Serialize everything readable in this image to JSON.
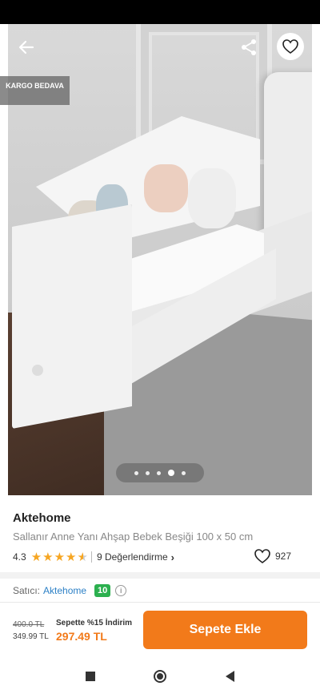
{
  "badge": {
    "shipping": "KARGO BEDAVA"
  },
  "gallery": {
    "image_count": 5,
    "active_index": 3
  },
  "product": {
    "brand": "Aktehome",
    "name": "Sallanır Anne Yanı Ahşap Bebek Beşiği 100 x 50 cm",
    "rating": "4.3",
    "rating_value": 4.3,
    "reviews_label": "9 Değerlendirme",
    "favorites": "927"
  },
  "seller": {
    "label": "Satıcı:",
    "name": "Aktehome",
    "score": "10"
  },
  "pricing": {
    "old_price": "400.0 TL",
    "price": "349.99 TL",
    "campaign": "Sepette %15 İndirim",
    "final_price": "297.49 TL",
    "cart_button": "Sepete Ekle"
  },
  "colors": {
    "accent": "#f27a1a",
    "seller_link": "#2c80c6",
    "score_badge": "#2cb04f",
    "star": "#f6a623"
  },
  "icons": [
    "back-arrow-icon",
    "share-icon",
    "heart-icon",
    "star-icon",
    "chevron-right-icon",
    "info-icon",
    "nav-recents-icon",
    "nav-home-icon",
    "nav-back-icon"
  ]
}
